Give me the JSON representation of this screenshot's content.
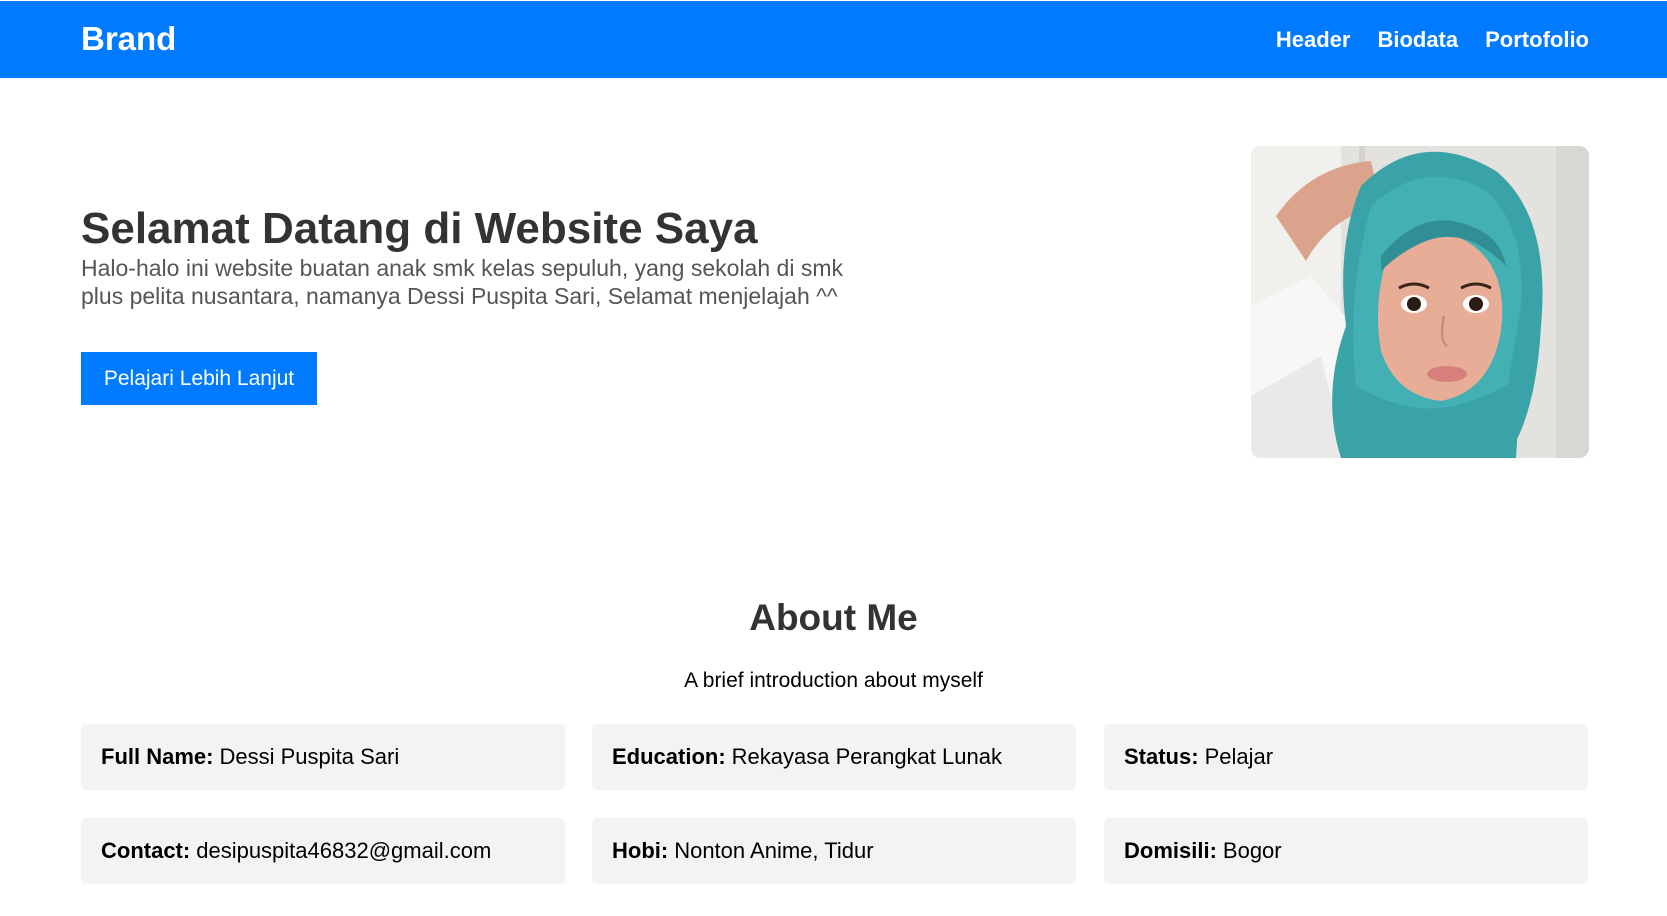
{
  "nav": {
    "brand": "Brand",
    "links": [
      "Header",
      "Biodata",
      "Portofolio"
    ]
  },
  "hero": {
    "title": "Selamat Datang di Website Saya",
    "text": "Halo-halo ini website buatan anak smk kelas sepuluh, yang sekolah di smk plus pelita nusantara, namanya Dessi Puspita Sari, Selamat menjelajah ^^",
    "button": "Pelajari Lebih Lanjut"
  },
  "about": {
    "title": "About Me",
    "subtitle": "A brief introduction about myself",
    "cards": [
      {
        "label": "Full Name:",
        "value": "Dessi Puspita Sari"
      },
      {
        "label": "Education:",
        "value": "Rekayasa Perangkat Lunak"
      },
      {
        "label": "Status:",
        "value": "Pelajar"
      },
      {
        "label": "Contact:",
        "value": "desipuspita46832@gmail.com"
      },
      {
        "label": "Hobi:",
        "value": "Nonton Anime, Tidur"
      },
      {
        "label": "Domisili:",
        "value": "Bogor"
      }
    ]
  },
  "colors": {
    "primary": "#007bff",
    "card_bg": "#f3f3f3",
    "hijab": "#3aa3a8"
  }
}
